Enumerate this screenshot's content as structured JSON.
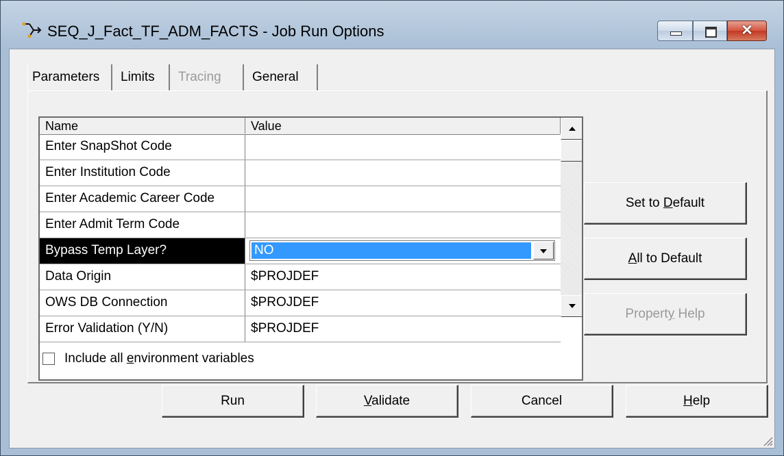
{
  "window": {
    "title": "SEQ_J_Fact_TF_ADM_FACTS - Job Run Options",
    "close_glyph": "✕"
  },
  "tabs": [
    {
      "label": "Parameters",
      "state": "active"
    },
    {
      "label": "Limits",
      "state": "normal"
    },
    {
      "label": "Tracing",
      "state": "disabled"
    },
    {
      "label": "General",
      "state": "normal"
    }
  ],
  "grid": {
    "columns": [
      "Name",
      "Value"
    ],
    "rows": [
      {
        "name": "Enter SnapShot Code",
        "value": ""
      },
      {
        "name": "Enter Institution Code",
        "value": ""
      },
      {
        "name": "Enter Academic Career Code",
        "value": ""
      },
      {
        "name": "Enter Admit Term Code",
        "value": ""
      },
      {
        "name": "Bypass Temp Layer?",
        "value": "NO",
        "selected": true
      },
      {
        "name": "Data Origin",
        "value": "$PROJDEF"
      },
      {
        "name": "OWS DB Connection",
        "value": "$PROJDEF"
      },
      {
        "name": "Error Validation (Y/N)",
        "value": "$PROJDEF"
      }
    ]
  },
  "side_buttons": {
    "set_default": {
      "prefix": "Set to ",
      "mnemonic": "D",
      "suffix": "efault"
    },
    "all_default": {
      "prefix": "",
      "mnemonic": "A",
      "suffix": "ll to Default"
    },
    "property_help": {
      "prefix": "Propert",
      "mnemonic": "y",
      "suffix": " Help"
    }
  },
  "checkbox": {
    "label_prefix": "Include all ",
    "label_mnemonic": "e",
    "label_suffix": "nvironment variables",
    "checked": false
  },
  "bottom_buttons": {
    "run": {
      "prefix": "Run",
      "mnemonic": "",
      "suffix": ""
    },
    "validate": {
      "prefix": "",
      "mnemonic": "V",
      "suffix": "alidate"
    },
    "cancel": {
      "prefix": "Cancel",
      "mnemonic": "",
      "suffix": ""
    },
    "help": {
      "prefix": "",
      "mnemonic": "H",
      "suffix": "elp"
    }
  },
  "colors": {
    "selection_highlight": "#3399ff",
    "selected_row_bg": "#000000",
    "dialog_bg": "#f0f0f0"
  }
}
